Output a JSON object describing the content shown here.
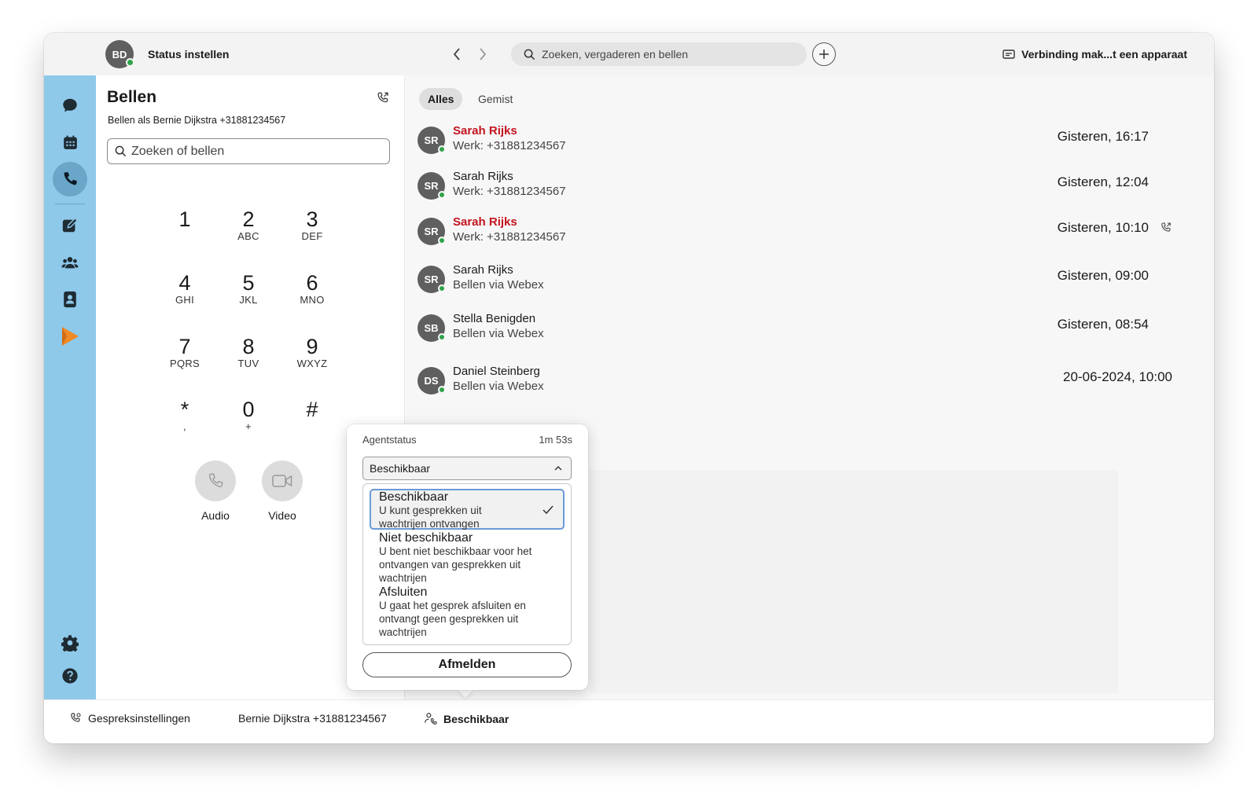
{
  "titlebar": {
    "avatar_initials": "BD",
    "status_label": "Status instellen",
    "search_placeholder": "Zoeken, vergaderen en bellen",
    "connect_label": "Verbinding mak...t een apparaat"
  },
  "sidebar": {
    "items": [
      {
        "name": "chat",
        "icon": "chat-bubble-icon"
      },
      {
        "name": "calendar",
        "icon": "calendar-icon"
      },
      {
        "name": "calling",
        "icon": "phone-icon",
        "active": true
      },
      {
        "name": "whiteboard",
        "icon": "compose-icon"
      },
      {
        "name": "teams",
        "icon": "people-icon"
      },
      {
        "name": "contacts",
        "icon": "contacts-icon"
      },
      {
        "name": "contact-center",
        "icon": "play-arrow-icon"
      },
      {
        "name": "settings",
        "icon": "gear-icon"
      },
      {
        "name": "help",
        "icon": "help-icon"
      }
    ]
  },
  "dialer": {
    "title": "Bellen",
    "calling_as": "Bellen als Bernie Dijkstra +31881234567",
    "search_placeholder": "Zoeken of bellen",
    "keys": [
      {
        "num": "1",
        "letters": ""
      },
      {
        "num": "2",
        "letters": "ABC"
      },
      {
        "num": "3",
        "letters": "DEF"
      },
      {
        "num": "4",
        "letters": "GHI"
      },
      {
        "num": "5",
        "letters": "JKL"
      },
      {
        "num": "6",
        "letters": "MNO"
      },
      {
        "num": "7",
        "letters": "PQRS"
      },
      {
        "num": "8",
        "letters": "TUV"
      },
      {
        "num": "9",
        "letters": "WXYZ"
      },
      {
        "num": "*",
        "letters": ","
      },
      {
        "num": "0",
        "letters": "+"
      },
      {
        "num": "#",
        "letters": ""
      }
    ],
    "audio_label": "Audio",
    "video_label": "Video"
  },
  "history": {
    "tabs": [
      {
        "label": "Alles",
        "active": true
      },
      {
        "label": "Gemist",
        "active": false
      }
    ],
    "rows": [
      {
        "initials": "SR",
        "name": "Sarah Rijks",
        "detail": "Werk: +31881234567",
        "time": "Gisteren, 16:17",
        "missed": true,
        "callback": false
      },
      {
        "initials": "SR",
        "name": "Sarah Rijks",
        "detail": "Werk: +31881234567",
        "time": "Gisteren, 12:04",
        "missed": false,
        "callback": false
      },
      {
        "initials": "SR",
        "name": "Sarah Rijks",
        "detail": "Werk: +31881234567",
        "time": "Gisteren, 10:10",
        "missed": true,
        "callback": true
      },
      {
        "initials": "SR",
        "name": "Sarah Rijks",
        "detail": "Bellen via Webex",
        "time": "Gisteren, 09:00",
        "missed": false,
        "callback": false
      },
      {
        "initials": "SB",
        "name": "Stella Benigden",
        "detail": "Bellen via Webex",
        "time": "Gisteren, 08:54",
        "missed": false,
        "callback": false
      },
      {
        "initials": "DS",
        "name": "Daniel Steinberg",
        "detail": "Bellen via Webex",
        "time": "20-06-2024, 10:00",
        "missed": false,
        "callback": false
      }
    ]
  },
  "agent_popup": {
    "title": "Agentstatus",
    "timer": "1m 53s",
    "selected": "Beschikbaar",
    "options": [
      {
        "title": "Beschikbaar",
        "desc": "U kunt gesprekken uit wachtrijen ontvangen",
        "selected": true
      },
      {
        "title": "Niet beschikbaar",
        "desc": "U bent niet beschikbaar voor het ontvangen van gesprekken uit wachtrijen",
        "selected": false
      },
      {
        "title": "Afsluiten",
        "desc": "U gaat het gesprek afsluiten en ontvangt geen gesprekken uit wachtrijen",
        "selected": false
      }
    ],
    "logout_label": "Afmelden"
  },
  "bottombar": {
    "call_settings": "Gespreksinstellingen",
    "user_number": "Bernie Dijkstra +31881234567",
    "agent_status": "Beschikbaar"
  },
  "colors": {
    "rail": "#8ec9ea",
    "missed": "#c3141e",
    "presence": "#2fa34a",
    "accent_orange": "#f08a24"
  }
}
